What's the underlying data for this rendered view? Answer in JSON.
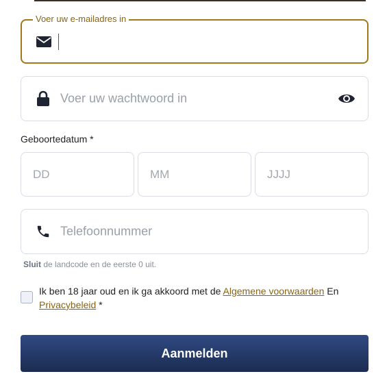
{
  "email": {
    "label": "Voer uw e-mailadres in",
    "value": ""
  },
  "password": {
    "placeholder": "Voer uw wachtwoord in"
  },
  "dob": {
    "label": "Geboortedatum *",
    "day_placeholder": "DD",
    "month_placeholder": "MM",
    "year_placeholder": "JJJJ"
  },
  "phone": {
    "placeholder": "Telefoonnummer",
    "hint_bold": "Sluit",
    "hint_rest": " de landcode en de eerste 0 uit."
  },
  "terms": {
    "text_before": "Ik ben 18 jaar oud en ik ga akkoord met de ",
    "terms_link": "Algemene voorwaarden",
    "text_middle": " En ",
    "privacy_link": "Privacybeleid",
    "required_mark": " *",
    "checked": false
  },
  "submit_label": "Aanmelden",
  "colors": {
    "accent": "#a0771a",
    "button": "#1c2c50"
  },
  "icons": [
    "envelope-icon",
    "lock-icon",
    "eye-icon",
    "phone-icon"
  ]
}
